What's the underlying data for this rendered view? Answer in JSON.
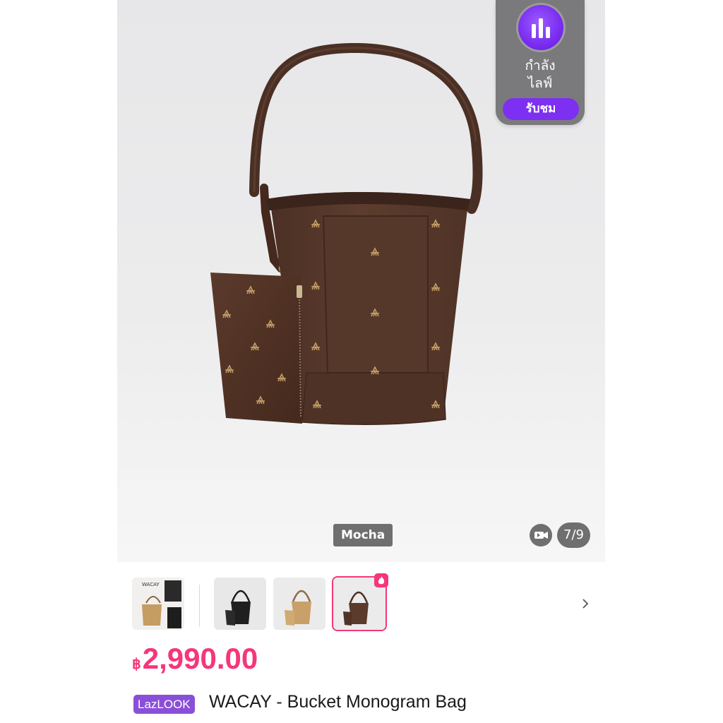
{
  "live_widget": {
    "line1": "กำลัง",
    "line2": "ไลฟ์",
    "button_label": "รับชม"
  },
  "gallery": {
    "variant_label": "Mocha",
    "counter": "7/9",
    "thumbnails": [
      {
        "name": "WACAY"
      },
      {
        "name": "Black"
      },
      {
        "name": "Tan"
      },
      {
        "name": "Mocha",
        "selected": true
      }
    ]
  },
  "product": {
    "currency": "฿",
    "price": "2,990.00",
    "tag": "LazLOOK",
    "title": "WACAY - Bucket Monogram Bag"
  },
  "colors": {
    "accent": "#f5367a",
    "live_purple": "#7d2ff2",
    "lazlook_purple": "#8a4fd9",
    "bag_brown": "#5a3b2c"
  }
}
